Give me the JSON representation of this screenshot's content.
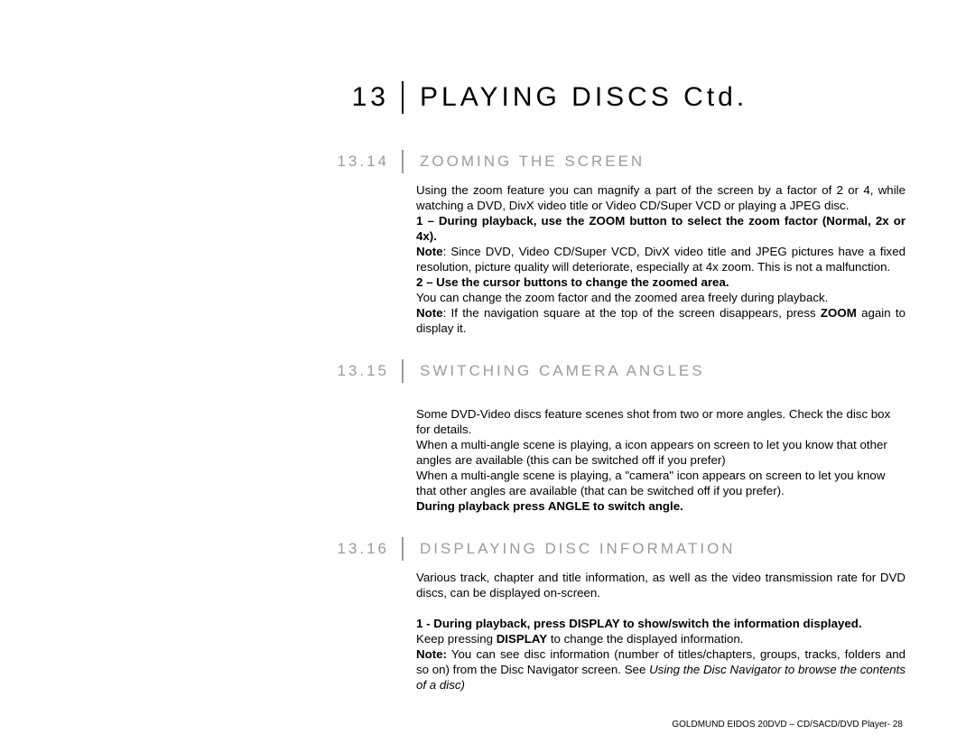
{
  "chapter": {
    "number": "13",
    "title": "PLAYING DISCS Ctd."
  },
  "sections": [
    {
      "number": "13.14",
      "title": "ZOOMING THE SCREEN",
      "body": [
        {
          "t": "p",
          "text": "Using the zoom feature you can magnify a part of the screen by a factor of 2 or 4, while watching a DVD, DivX video title or Video CD/Super VCD or playing a JPEG disc."
        },
        {
          "t": "pb",
          "text": "1 – During playback, use the ZOOM button to select the zoom factor (Normal, 2x or 4x)."
        },
        {
          "t": "p_note",
          "label": "Note",
          "text": ": Since DVD, Video CD/Super VCD, DivX video title and JPEG pictures have a fixed resolution, picture quality will deteriorate, especially at 4x zoom. This is not a malfunction."
        },
        {
          "t": "pb",
          "text": "2 – Use the cursor buttons to change the zoomed area."
        },
        {
          "t": "p",
          "text": "You can change the zoom factor and the zoomed area freely during playback."
        },
        {
          "t": "p_zoom",
          "label": "Note",
          "text1": ": If the navigation square at the top of the screen disappears, press ",
          "zoom": "ZOOM",
          "text2": " again to display it."
        }
      ]
    },
    {
      "number": "13.15",
      "title": "SWITCHING CAMERA ANGLES",
      "body": [
        {
          "t": "p",
          "text": "Some DVD-Video discs feature scenes shot from two or more angles. Check the disc box for details."
        },
        {
          "t": "p",
          "text": "When a multi-angle scene is playing, a icon appears on screen to let you know that other angles are available (this can be switched off if you prefer)"
        },
        {
          "t": "p",
          "text": "When a multi-angle scene is playing, a \"camera\" icon appears on screen to let you know that other angles are available (that can be switched off if you prefer)."
        },
        {
          "t": "pb",
          "text": "During playback press ANGLE to switch angle."
        }
      ]
    },
    {
      "number": "13.16",
      "title": "DISPLAYING DISC INFORMATION",
      "body": [
        {
          "t": "p",
          "text": "Various track, chapter and title information, as well as the video transmission rate for DVD discs, can be displayed on-screen."
        },
        {
          "t": "sp"
        },
        {
          "t": "pb",
          "text": "1 - During playback, press DISPLAY to show/switch the information displayed."
        },
        {
          "t": "p_disp",
          "text1": "Keep pressing ",
          "disp": "DISPLAY",
          "text2": " to change the displayed information."
        },
        {
          "t": "p_nav",
          "label": "Note:",
          "text1": " You can see disc information (number of titles/chapters, groups, tracks, folders and so on) from the Disc Navigator screen. See ",
          "ital": "Using the Disc Navigator to browse the contents of a disc)"
        }
      ]
    }
  ],
  "footer": "GOLDMUND EIDOS 20DVD – CD/SACD/DVD Player- 28"
}
